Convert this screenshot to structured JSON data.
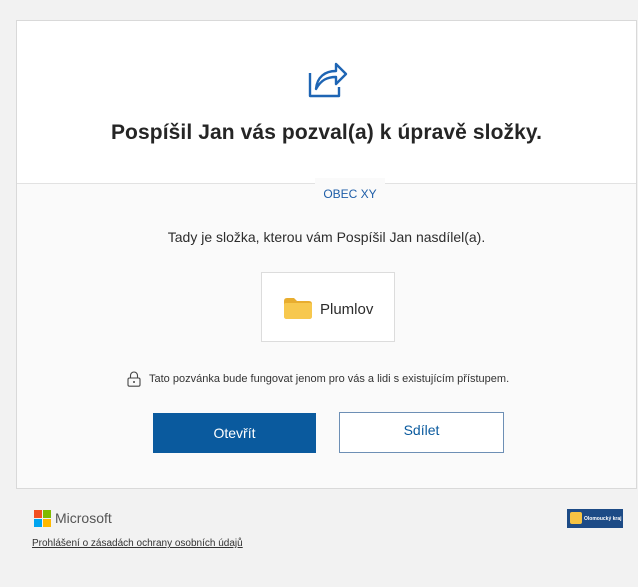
{
  "invite": {
    "title": "Pospíšil Jan vás pozval(a) k úpravě složky.",
    "organization": "OBEC XY",
    "description": "Tady je složka, kterou vám Pospíšil Jan nasdílel(a).",
    "folder_name": "Plumlov",
    "notice": "Tato pozvánka bude fungovat jenom pro vás a lidi s existujícím přístupem.",
    "open_button": "Otevřít",
    "share_button": "Sdílet"
  },
  "footer": {
    "brand": "Microsoft",
    "privacy_link": "Prohlášení o zásadách ochrany osobních údajů",
    "region_logo_text": "Olomoucký kraj"
  },
  "icons": {
    "share": "share-icon",
    "folder": "folder-icon",
    "lock": "lock-icon",
    "microsoft_logo": "microsoft-logo"
  },
  "colors": {
    "accent": "#0a5a9e",
    "folder": "#f3c04c",
    "ms_red": "#f25022",
    "ms_green": "#7fba00",
    "ms_blue": "#00a4ef",
    "ms_yellow": "#ffb900"
  }
}
